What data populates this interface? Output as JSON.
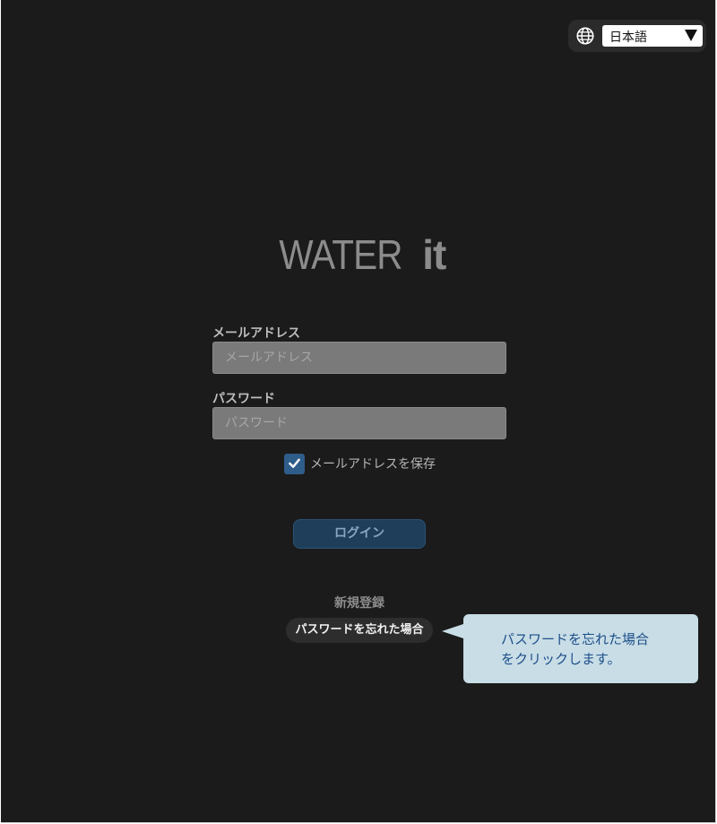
{
  "language": {
    "selected": "日本語",
    "globe_icon": "globe-icon",
    "arrow_icon": "triangle-down-icon"
  },
  "logo": {
    "light": "WATER",
    "bold": "it"
  },
  "form": {
    "email_label": "メールアドレス",
    "email_placeholder": "メールアドレス",
    "email_value": "",
    "password_label": "パスワード",
    "password_placeholder": "パスワード",
    "password_value": "",
    "remember_label": "メールアドレスを保存",
    "remember_checked": true,
    "login_label": "ログイン"
  },
  "links": {
    "register": "新規登録",
    "forgot_password": "パスワードを忘れた場合"
  },
  "callout": {
    "line1": "パスワードを忘れた場合",
    "line2": "をクリックします。"
  },
  "colors": {
    "background": "#1b1b1b",
    "accent": "#1f3e5a",
    "callout": "#c8dde6",
    "callout_text": "#1e4f8a"
  }
}
